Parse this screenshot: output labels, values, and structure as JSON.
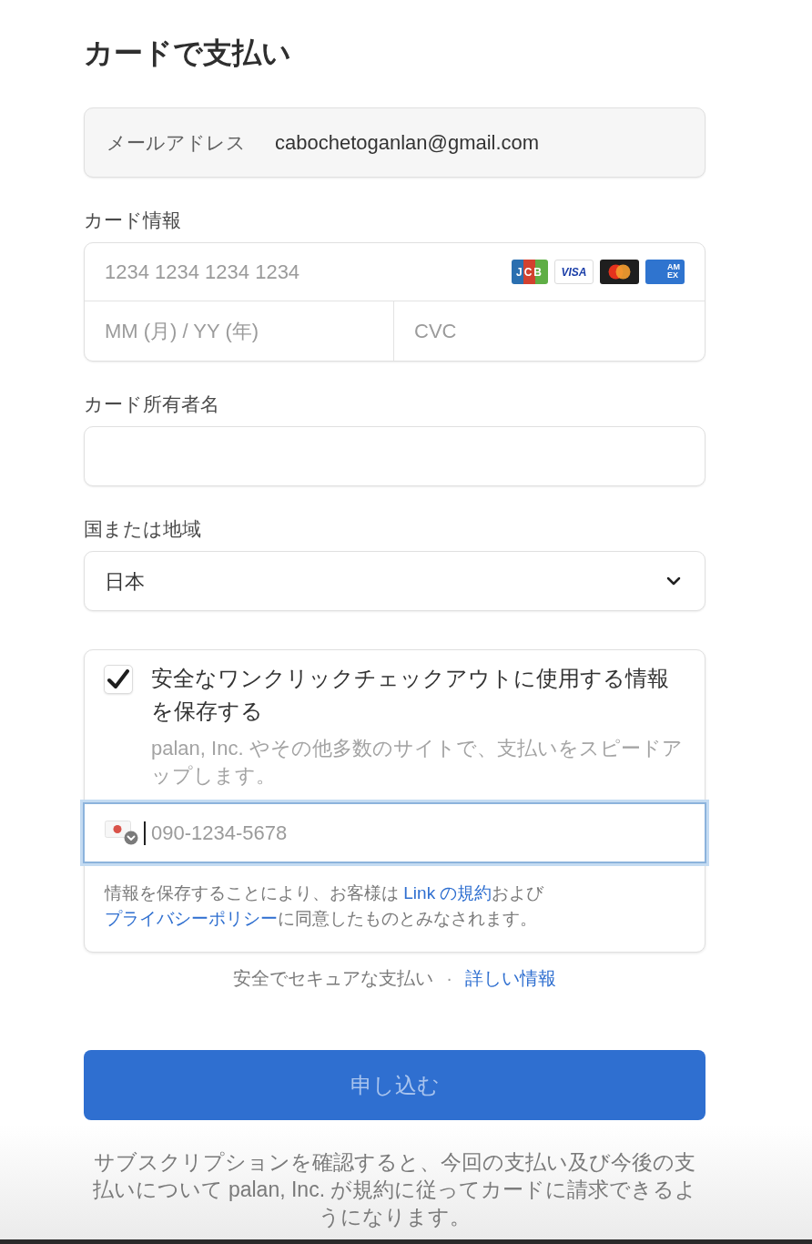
{
  "title": "カードで支払い",
  "email": {
    "label": "メールアドレス",
    "value": "cabochetoganlan@gmail.com"
  },
  "card_info": {
    "label": "カード情報",
    "number_placeholder": "1234 1234 1234 1234",
    "brands": [
      {
        "kind": "jcb",
        "label": "JCB"
      },
      {
        "kind": "visa",
        "label": "VISA"
      },
      {
        "kind": "mastercard"
      },
      {
        "kind": "amex",
        "label": "AMEX"
      }
    ],
    "expiry_placeholder": "MM (月) / YY (年)",
    "cvc_placeholder": "CVC"
  },
  "cardholder": {
    "label": "カード所有者名"
  },
  "country": {
    "label": "国または地域",
    "value": "日本"
  },
  "link": {
    "save": {
      "label": "安全なワンクリックチェックアウトに使用する情報を保存する",
      "checked": true
    },
    "description": "palan, Inc. やその他多数のサイトで、支払いをスピードアップします。",
    "phone": {
      "placeholder": "090-1234-5678",
      "focused": true
    },
    "legal": [
      {
        "kind": "text",
        "text": "情報を保存することにより、お客様は "
      },
      {
        "kind": "link",
        "text": "Link の規約"
      },
      {
        "kind": "text",
        "text": "および"
      },
      {
        "kind": "link",
        "text": "プライバシーポリシー"
      },
      {
        "kind": "text",
        "text": "に同意したものとみなされます。"
      }
    ]
  },
  "secure": {
    "text": "安全でセキュアな支払い",
    "separator": "·",
    "link": "詳しい情報"
  },
  "submit": {
    "label": "申し込む",
    "disabled": true
  },
  "footer": "サブスクリプションを確認すると、今回の支払い及び今後の支払いについて palan, Inc. が規約に従ってカードに請求できるようになります。"
}
